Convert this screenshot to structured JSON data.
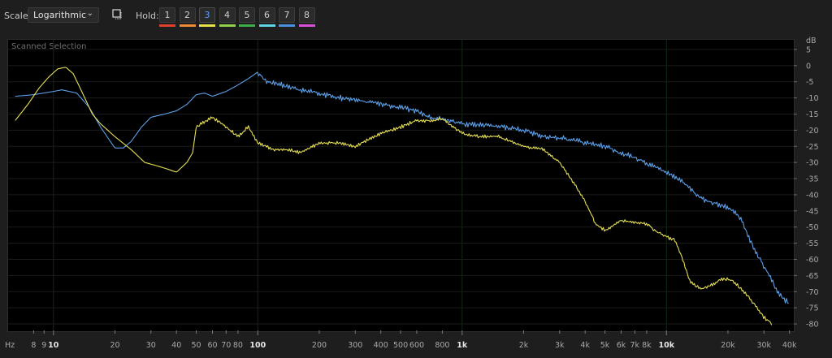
{
  "toolbar": {
    "scale_label": "Scale:",
    "scale_value": "Logarithmic",
    "hold_label": "Hold:",
    "hold_buttons": [
      {
        "label": "1",
        "color": "#e0412e",
        "active": false
      },
      {
        "label": "2",
        "color": "#ee8a33",
        "active": false
      },
      {
        "label": "3",
        "color": "#e8e24a",
        "active": true
      },
      {
        "label": "4",
        "color": "#8fd14a",
        "active": false
      },
      {
        "label": "5",
        "color": "#3fae4a",
        "active": false
      },
      {
        "label": "6",
        "color": "#5fd6e8",
        "active": false
      },
      {
        "label": "7",
        "color": "#4c8fe0",
        "active": false
      },
      {
        "label": "8",
        "color": "#d84fd8",
        "active": false
      }
    ]
  },
  "chart_data": {
    "type": "line",
    "title": "Scanned Selection",
    "xlabel": "Hz",
    "ylabel": "dB",
    "xscale": "log",
    "xlim": [
      6,
      42000
    ],
    "ylim": [
      -82,
      8
    ],
    "grid": true,
    "x_ticks": [
      {
        "value": 8,
        "label": "8"
      },
      {
        "value": 9,
        "label": "9"
      },
      {
        "value": 10,
        "label": "10",
        "major": true
      },
      {
        "value": 20,
        "label": "20"
      },
      {
        "value": 30,
        "label": "30"
      },
      {
        "value": 40,
        "label": "40"
      },
      {
        "value": 50,
        "label": "50"
      },
      {
        "value": 60,
        "label": "60"
      },
      {
        "value": 70,
        "label": "70"
      },
      {
        "value": 80,
        "label": "80"
      },
      {
        "value": 100,
        "label": "100",
        "major": true
      },
      {
        "value": 200,
        "label": "200"
      },
      {
        "value": 300,
        "label": "300"
      },
      {
        "value": 400,
        "label": "400"
      },
      {
        "value": 500,
        "label": "500"
      },
      {
        "value": 600,
        "label": "600"
      },
      {
        "value": 800,
        "label": "800"
      },
      {
        "value": 1000,
        "label": "1k",
        "major": true
      },
      {
        "value": 2000,
        "label": "2k"
      },
      {
        "value": 3000,
        "label": "3k"
      },
      {
        "value": 4000,
        "label": "4k"
      },
      {
        "value": 5000,
        "label": "5k"
      },
      {
        "value": 6000,
        "label": "6k"
      },
      {
        "value": 7000,
        "label": "7k"
      },
      {
        "value": 8000,
        "label": "8k"
      },
      {
        "value": 10000,
        "label": "10k",
        "major": true
      },
      {
        "value": 20000,
        "label": "20k"
      },
      {
        "value": 30000,
        "label": "30k"
      },
      {
        "value": 40000,
        "label": "40k"
      }
    ],
    "y_ticks": [
      5,
      0,
      -5,
      -10,
      -15,
      -20,
      -25,
      -30,
      -35,
      -40,
      -45,
      -50,
      -55,
      -60,
      -65,
      -70,
      -75,
      -80
    ],
    "series": [
      {
        "color": "#5b9fe8",
        "jitter_from": 100,
        "points": [
          [
            6.5,
            -9.5
          ],
          [
            8,
            -9
          ],
          [
            10,
            -8
          ],
          [
            11,
            -7.5
          ],
          [
            13,
            -8.5
          ],
          [
            15,
            -13
          ],
          [
            17,
            -19
          ],
          [
            19,
            -23.5
          ],
          [
            20,
            -25.5
          ],
          [
            22,
            -25.5
          ],
          [
            24,
            -23.5
          ],
          [
            27,
            -19
          ],
          [
            30,
            -16
          ],
          [
            35,
            -15
          ],
          [
            40,
            -14
          ],
          [
            45,
            -12
          ],
          [
            50,
            -9
          ],
          [
            55,
            -8.5
          ],
          [
            60,
            -9.5
          ],
          [
            70,
            -8
          ],
          [
            80,
            -6
          ],
          [
            90,
            -4
          ],
          [
            100,
            -2
          ],
          [
            110,
            -5
          ],
          [
            130,
            -6
          ],
          [
            160,
            -7.5
          ],
          [
            200,
            -8.5
          ],
          [
            250,
            -10
          ],
          [
            300,
            -10.5
          ],
          [
            400,
            -12
          ],
          [
            500,
            -13
          ],
          [
            600,
            -14
          ],
          [
            700,
            -16
          ],
          [
            800,
            -16.5
          ],
          [
            1000,
            -18
          ],
          [
            1300,
            -18.5
          ],
          [
            1600,
            -19
          ],
          [
            2000,
            -20
          ],
          [
            2500,
            -22
          ],
          [
            3000,
            -22.5
          ],
          [
            3500,
            -23
          ],
          [
            4000,
            -24
          ],
          [
            5000,
            -25
          ],
          [
            6000,
            -27
          ],
          [
            7000,
            -28.5
          ],
          [
            8000,
            -30.5
          ],
          [
            10000,
            -33
          ],
          [
            12000,
            -36
          ],
          [
            13000,
            -38
          ],
          [
            14000,
            -40
          ],
          [
            16000,
            -42
          ],
          [
            18000,
            -43
          ],
          [
            20000,
            -44
          ],
          [
            23000,
            -47
          ],
          [
            26000,
            -55
          ],
          [
            30000,
            -62
          ],
          [
            35000,
            -70
          ],
          [
            40000,
            -74
          ]
        ]
      },
      {
        "color": "#e6df55",
        "jitter_from": 50,
        "points": [
          [
            6.5,
            -17
          ],
          [
            7.5,
            -12
          ],
          [
            8.5,
            -7
          ],
          [
            9.5,
            -3.5
          ],
          [
            10.5,
            -1
          ],
          [
            11.5,
            -0.5
          ],
          [
            12.5,
            -2.5
          ],
          [
            14,
            -9
          ],
          [
            15.5,
            -15
          ],
          [
            17,
            -18
          ],
          [
            20,
            -22
          ],
          [
            24,
            -26
          ],
          [
            28,
            -30
          ],
          [
            32,
            -31
          ],
          [
            36,
            -32
          ],
          [
            40,
            -33
          ],
          [
            45,
            -30
          ],
          [
            48,
            -27
          ],
          [
            50,
            -19
          ],
          [
            60,
            -16
          ],
          [
            70,
            -19
          ],
          [
            80,
            -22
          ],
          [
            90,
            -19
          ],
          [
            100,
            -24
          ],
          [
            120,
            -26
          ],
          [
            140,
            -26
          ],
          [
            160,
            -27
          ],
          [
            200,
            -24
          ],
          [
            250,
            -24
          ],
          [
            300,
            -25
          ],
          [
            400,
            -21
          ],
          [
            500,
            -19
          ],
          [
            600,
            -17
          ],
          [
            700,
            -17
          ],
          [
            800,
            -16.5
          ],
          [
            1000,
            -21
          ],
          [
            1200,
            -22
          ],
          [
            1500,
            -22
          ],
          [
            2000,
            -25
          ],
          [
            2500,
            -26
          ],
          [
            3000,
            -30
          ],
          [
            3500,
            -36
          ],
          [
            4000,
            -42
          ],
          [
            4500,
            -49
          ],
          [
            5000,
            -51
          ],
          [
            6000,
            -48
          ],
          [
            7000,
            -48.5
          ],
          [
            8000,
            -49
          ],
          [
            9000,
            -51.5
          ],
          [
            10000,
            -53
          ],
          [
            11000,
            -54
          ],
          [
            12000,
            -60
          ],
          [
            13000,
            -66.5
          ],
          [
            14000,
            -68.5
          ],
          [
            15000,
            -69
          ],
          [
            17000,
            -67.5
          ],
          [
            19000,
            -66
          ],
          [
            21000,
            -66.5
          ],
          [
            24000,
            -70
          ],
          [
            27000,
            -74
          ],
          [
            30000,
            -78
          ],
          [
            33000,
            -80
          ]
        ]
      }
    ]
  }
}
